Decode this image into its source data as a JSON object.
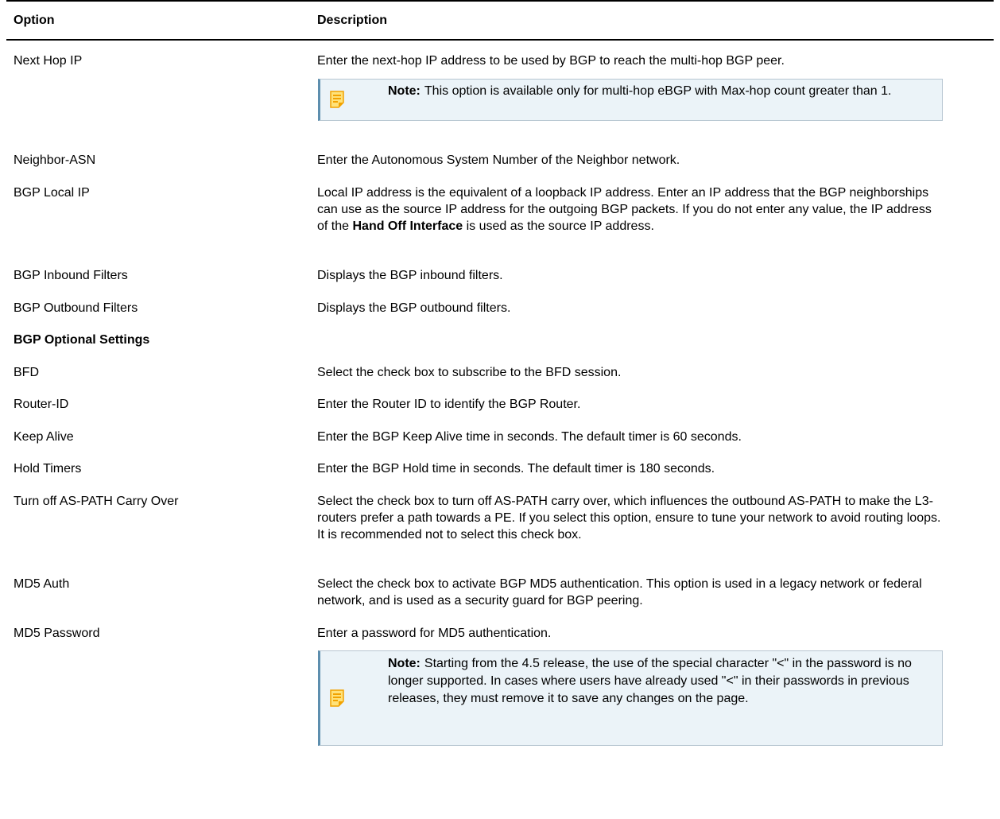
{
  "table": {
    "header": {
      "option": "Option",
      "description": "Description"
    },
    "rows": [
      {
        "option": "Next Hop IP",
        "description": "Enter the next-hop IP address to be used by BGP to reach the multi-hop BGP peer.",
        "note": {
          "label": "Note:",
          "text": "This option is available only for multi-hop eBGP with Max-hop count greater than 1."
        }
      },
      {
        "option": "Neighbor-ASN",
        "description": "Enter the Autonomous System Number of the Neighbor network."
      },
      {
        "option": "BGP Local IP",
        "description_before": "Local IP address is the equivalent of a loopback IP address. Enter an IP address that the BGP neighborships can use as the source IP address for the outgoing BGP packets. If you do not enter any value, the IP address of the ",
        "description_bold": "Hand Off Interface",
        "description_after": " is used as the source IP address."
      },
      {
        "option": "BGP Inbound Filters",
        "description": "Displays the BGP inbound filters."
      },
      {
        "option": "BGP Outbound Filters",
        "description": "Displays the BGP outbound filters."
      },
      {
        "option": "BGP Optional Settings"
      },
      {
        "option": "BFD",
        "description": "Select the check box to subscribe to the BFD session."
      },
      {
        "option": "Router-ID",
        "description": "Enter the Router ID to identify the BGP Router."
      },
      {
        "option": "Keep Alive",
        "description": "Enter the BGP Keep Alive time in seconds. The default timer is 60 seconds."
      },
      {
        "option": "Hold Timers",
        "description": "Enter the BGP Hold time in seconds. The default timer is 180 seconds."
      },
      {
        "option": "Turn off AS-PATH Carry Over",
        "description": "Select the check box to turn off AS-PATH carry over, which influences the outbound AS-PATH to make the L3-routers prefer a path towards a PE. If you select this option, ensure to tune your network to avoid routing loops. It is recommended not to select this check box."
      },
      {
        "option": "MD5 Auth",
        "description": "Select the check box to activate BGP MD5 authentication. This option is used in a legacy network or federal network, and is used as a security guard for BGP peering."
      },
      {
        "option": "MD5 Password",
        "description": "Enter a password for MD5 authentication.",
        "note": {
          "label": "Note:",
          "text": "Starting from the 4.5 release, the use of the special character \"<\" in the password is no longer supported. In cases where users have already used \"<\" in their passwords in previous releases, they must remove it to save any changes on the page."
        }
      }
    ]
  },
  "colors": {
    "note_background": "#ebf3f8",
    "note_accent": "#5d8eae",
    "note_icon": "#f2a200"
  },
  "icons": {
    "note": "note-icon"
  }
}
